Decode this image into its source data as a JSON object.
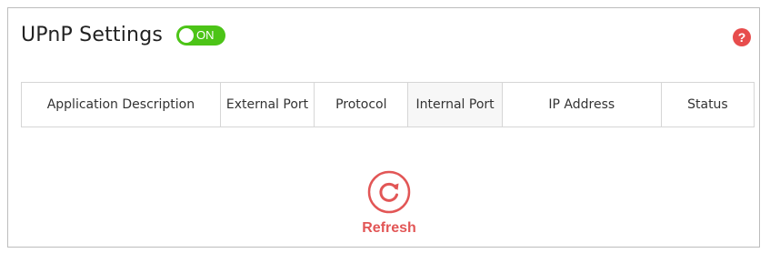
{
  "header": {
    "title": "UPnP Settings",
    "toggle_label": "ON",
    "toggle_state": "on",
    "help_label": "?"
  },
  "table": {
    "columns": [
      "Application Description",
      "External Port",
      "Protocol",
      "Internal Port",
      "IP Address",
      "Status"
    ],
    "rows": []
  },
  "refresh": {
    "label": "Refresh",
    "icon": "refresh-icon"
  },
  "colors": {
    "toggle_on": "#4cc417",
    "accent_red": "#e25656",
    "help_badge": "#e74c4c"
  }
}
